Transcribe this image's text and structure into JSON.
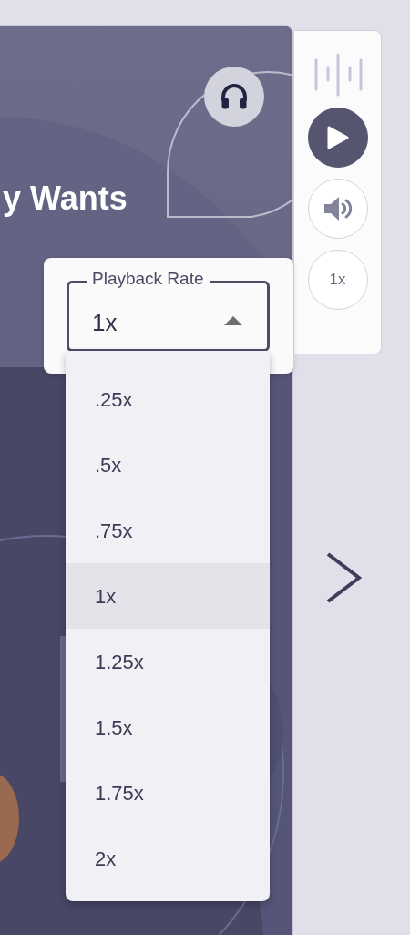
{
  "card": {
    "title": "y Wants"
  },
  "side_controls": {
    "speed_label": "1x"
  },
  "playback_rate": {
    "label": "Playback Rate",
    "value": "1x",
    "expanded": true
  },
  "rate_options": [
    {
      "label": ".25x",
      "selected": false
    },
    {
      "label": ".5x",
      "selected": false
    },
    {
      "label": ".75x",
      "selected": false
    },
    {
      "label": "1x",
      "selected": true
    },
    {
      "label": "1.25x",
      "selected": false
    },
    {
      "label": "1.5x",
      "selected": false
    },
    {
      "label": "1.75x",
      "selected": false
    },
    {
      "label": "2x",
      "selected": false
    }
  ]
}
